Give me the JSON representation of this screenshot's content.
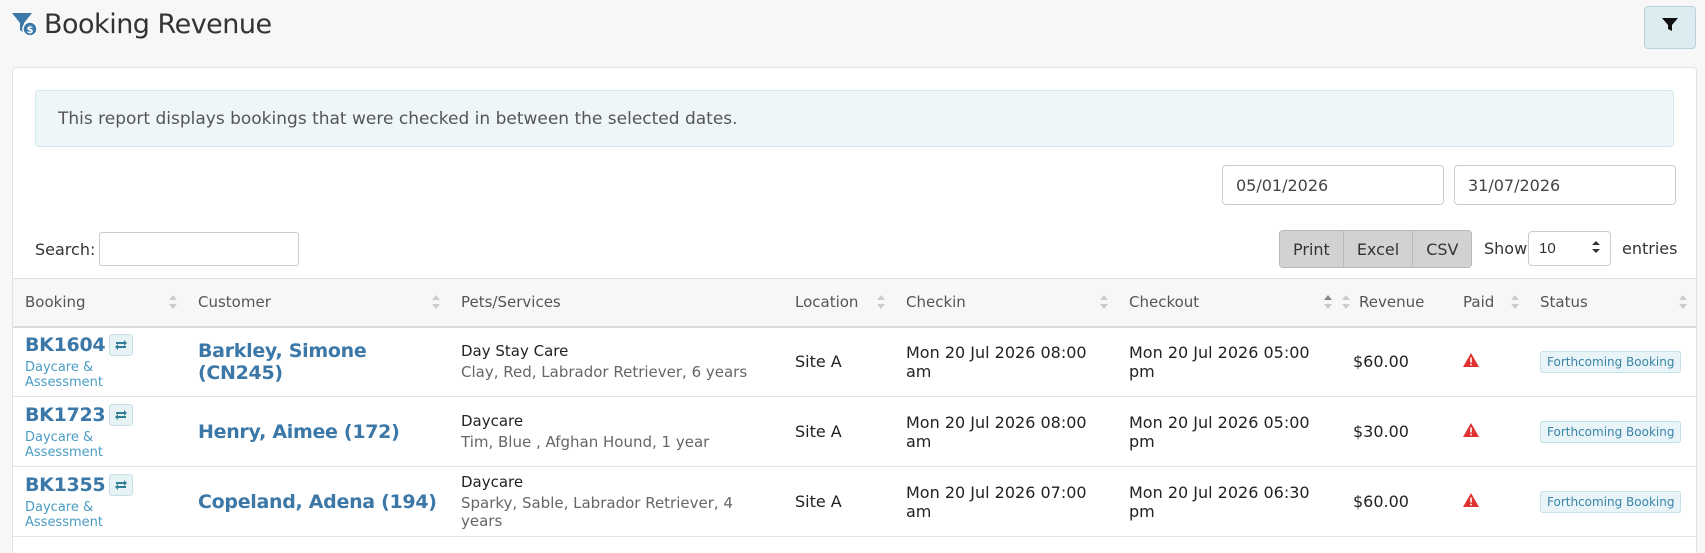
{
  "page": {
    "title": "Booking Revenue"
  },
  "info_text": "This report displays bookings that were checked in between the selected dates.",
  "filters": {
    "date_from": "05/01/2026",
    "date_to": "31/07/2026"
  },
  "search": {
    "label": "Search:",
    "value": ""
  },
  "export": {
    "print": "Print",
    "excel": "Excel",
    "csv": "CSV"
  },
  "page_size": {
    "show_label": "Show",
    "value": "10",
    "entries_label": "entries"
  },
  "table": {
    "columns": [
      "Booking",
      "Customer",
      "Pets/Services",
      "Location",
      "Checkin",
      "Checkout",
      "Revenue",
      "Paid",
      "Status"
    ],
    "rows": [
      {
        "booking_id": "BK1604",
        "booking_type": "Daycare & Assessment",
        "customer": "Barkley, Simone (CN245)",
        "service": "Day Stay Care",
        "pets": "Clay, Red, Labrador Retriever, 6 years",
        "location": "Site A",
        "checkin": "Mon 20 Jul 2026 08:00 am",
        "checkout": "Mon 20 Jul 2026 05:00 pm",
        "revenue": "$60.00",
        "paid_icon": "warning-icon",
        "status": "Forthcoming Booking"
      },
      {
        "booking_id": "BK1723",
        "booking_type": "Daycare & Assessment",
        "customer": "Henry, Aimee (172)",
        "service": "Daycare",
        "pets": "Tim, Blue , Afghan Hound, 1 year",
        "location": "Site A",
        "checkin": "Mon 20 Jul 2026 08:00 am",
        "checkout": "Mon 20 Jul 2026 05:00 pm",
        "revenue": "$30.00",
        "paid_icon": "warning-icon",
        "status": "Forthcoming Booking"
      },
      {
        "booking_id": "BK1355",
        "booking_type": "Daycare & Assessment",
        "customer": "Copeland, Adena (194)",
        "service": "Daycare",
        "pets": "Sparky, Sable, Labrador Retriever, 4 years",
        "location": "Site A",
        "checkin": "Mon 20 Jul 2026 07:00 am",
        "checkout": "Mon 20 Jul 2026 06:30 pm",
        "revenue": "$60.00",
        "paid_icon": "warning-icon",
        "status": "Forthcoming Booking"
      }
    ]
  },
  "colors": {
    "link": "#3b78a8",
    "badge": "#3a85a6",
    "warning": "#e03131",
    "info_bg": "#eef6f8"
  }
}
